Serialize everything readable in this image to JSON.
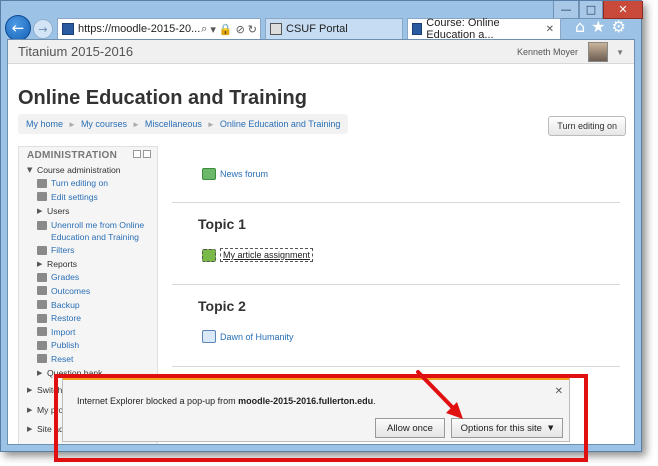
{
  "browser": {
    "address_url": "https://moodle-2015-20...",
    "tabs": [
      {
        "label": "CSUF Portal"
      },
      {
        "label": "Course: Online Education a..."
      }
    ],
    "window_controls": {
      "minimize": "—",
      "maximize": "□",
      "close": "✕"
    }
  },
  "header": {
    "site_name": "Titanium 2015-2016",
    "user_name": "Kenneth Moyer"
  },
  "page": {
    "title": "Online Education and Training",
    "breadcrumb": [
      "My home",
      "My courses",
      "Miscellaneous",
      "Online Education and Training"
    ],
    "turn_editing_label": "Turn editing on"
  },
  "admin": {
    "title": "ADMINISTRATION",
    "course_admin_label": "Course administration",
    "items": [
      {
        "label": "Turn editing on",
        "icon": "pencil-icon",
        "link": true
      },
      {
        "label": "Edit settings",
        "icon": "gear-icon",
        "link": true
      },
      {
        "label": "Users",
        "icon": "triangle-icon",
        "link": false
      },
      {
        "label": "Unenroll me from Online",
        "label2": "Education and Training",
        "icon": "user-icon",
        "link": true
      },
      {
        "label": "Filters",
        "icon": "filter-icon",
        "link": true
      },
      {
        "label": "Reports",
        "icon": "triangle-icon",
        "link": false
      },
      {
        "label": "Grades",
        "icon": "grades-icon",
        "link": true
      },
      {
        "label": "Outcomes",
        "icon": "outcomes-icon",
        "link": true
      },
      {
        "label": "Backup",
        "icon": "backup-icon",
        "link": true
      },
      {
        "label": "Restore",
        "icon": "restore-icon",
        "link": true
      },
      {
        "label": "Import",
        "icon": "import-icon",
        "link": true
      },
      {
        "label": "Publish",
        "icon": "publish-icon",
        "link": true
      },
      {
        "label": "Reset",
        "icon": "reset-icon",
        "link": true
      },
      {
        "label": "Question bank",
        "icon": "triangle-icon",
        "link": false
      }
    ],
    "bottom_rows": [
      "Switch",
      "My profi",
      "Site ad"
    ]
  },
  "main": {
    "news_forum": "News forum",
    "topics": [
      {
        "title": "Topic 1",
        "activity": "My article assignment"
      },
      {
        "title": "Topic 2",
        "activity": "Dawn of Humanity"
      }
    ]
  },
  "popup": {
    "message_prefix": "Internet Explorer blocked a pop-up from ",
    "message_site": "moodle-2015-2016.fullerton.edu",
    "message_suffix": ".",
    "allow_label": "Allow once",
    "options_label": "Options for this site",
    "close_glyph": "✕"
  },
  "colors": {
    "annotation": "#e01010",
    "popup_accent": "#f3a21b",
    "link": "#2a6fb5"
  }
}
